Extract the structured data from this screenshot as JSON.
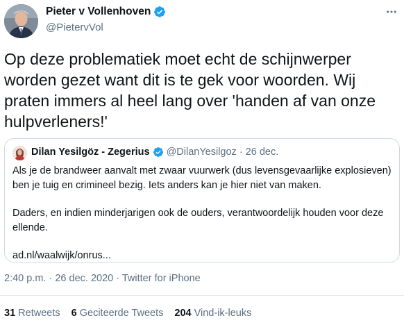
{
  "author": {
    "name": "Pieter v Vollenhoven",
    "handle": "@PietervVol",
    "verified_icon": "verified-badge-icon",
    "verified_color": "#1da1f2"
  },
  "tweet": {
    "text": "Op deze problematiek moet echt de schijnwerper worden gezet want dit is te gek voor woorden. Wij praten immers al heel lang over 'handen af van onze hulpverleners!'"
  },
  "quote": {
    "name": "Dilan Yesilgöz - Zegerius",
    "handle": "@DilanYesilgoz",
    "separator": "·",
    "date": "26 dec.",
    "paragraph1": "Als je de brandweer aanvalt met zwaar vuurwerk (dus levensgevaarlijke explosieven) ben je tuig en crimineel bezig. Iets anders kan je hier niet van maken.",
    "paragraph2": "Daders, en indien minderjarigen ook de ouders, verantwoordelijk houden voor deze ellende.",
    "link": "ad.nl/waalwijk/onrus..."
  },
  "meta": {
    "time": "2:40 p.m.",
    "sep1": "·",
    "date": "26 dec. 2020",
    "sep2": "·",
    "source": "Twitter for iPhone"
  },
  "stats": {
    "retweets_count": "31",
    "retweets_label": "Retweets",
    "quotes_count": "6",
    "quotes_label": "Geciteerde Tweets",
    "likes_count": "204",
    "likes_label": "Vind-ik-leuks"
  },
  "colors": {
    "text": "#0f1419",
    "secondary": "#5b7083",
    "border": "#cfd9de",
    "accent": "#1da1f2"
  }
}
